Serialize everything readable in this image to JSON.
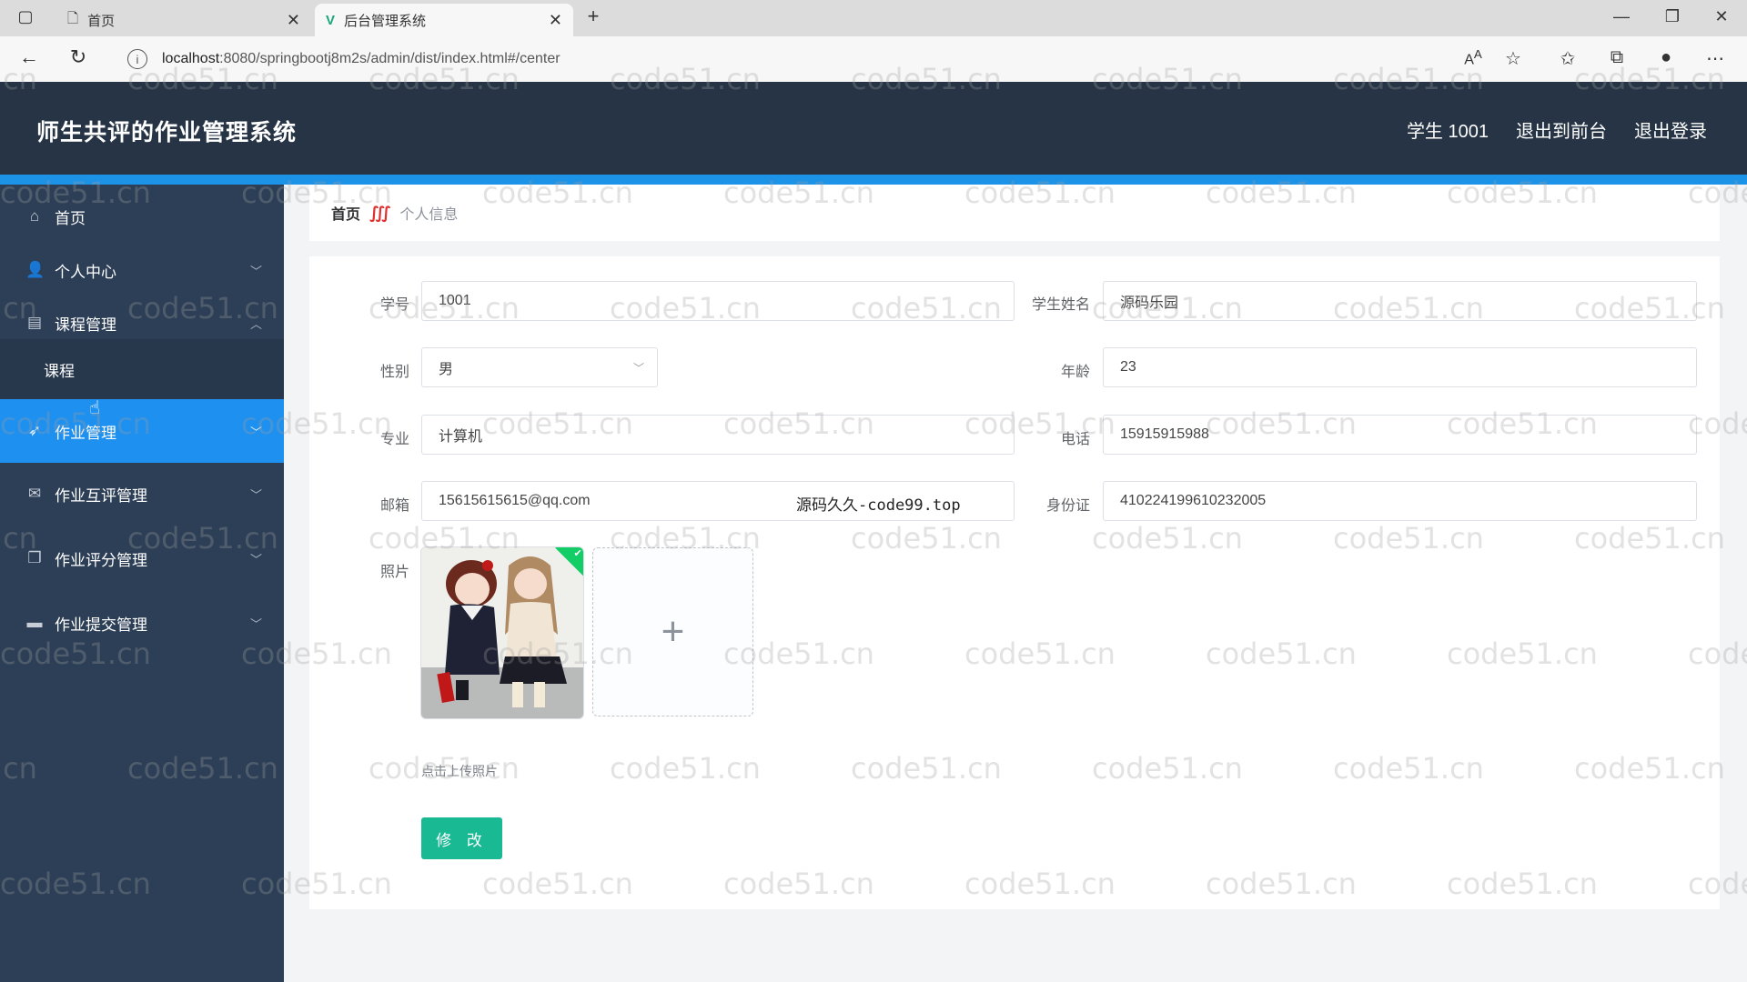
{
  "browser": {
    "tabs": [
      {
        "title": "首页"
      },
      {
        "title": "后台管理系统"
      }
    ],
    "url_host": "localhost",
    "url_path": ":8080/springbootj8m2s/admin/dist/index.html#/center"
  },
  "header": {
    "app_title": "师生共评的作业管理系统",
    "user": "学生 1001",
    "back_to_front": "退出到前台",
    "logout": "退出登录"
  },
  "sidebar": {
    "items": [
      {
        "label": "首页",
        "icon": "home-icon"
      },
      {
        "label": "个人中心",
        "icon": "user-icon"
      },
      {
        "label": "课程管理",
        "icon": "clipboard-icon",
        "expanded": true
      },
      {
        "label": "课程",
        "sub": true
      },
      {
        "label": "作业管理",
        "icon": "send-icon",
        "active": true
      },
      {
        "label": "作业互评管理",
        "icon": "mail-icon"
      },
      {
        "label": "作业评分管理",
        "icon": "copy-icon"
      },
      {
        "label": "作业提交管理",
        "icon": "monitor-icon"
      }
    ]
  },
  "breadcrumb": {
    "home": "首页",
    "current": "个人信息"
  },
  "form": {
    "student_no_label": "学号",
    "student_no": "1001",
    "student_name_label": "学生姓名",
    "student_name": "源码乐园",
    "gender_label": "性别",
    "gender": "男",
    "age_label": "年龄",
    "age": "23",
    "major_label": "专业",
    "major": "计算机",
    "phone_label": "电话",
    "phone": "15915915988",
    "email_label": "邮箱",
    "email": "15615615615@qq.com",
    "id_card_label": "身份证",
    "id_card": "410224199610232005",
    "photo_label": "照片",
    "upload_tip": "点击上传照片",
    "submit": "修 改"
  },
  "overlay_text": "源码久久-code99.top",
  "watermark": "code51.cn",
  "colors": {
    "header_bg": "#263445",
    "sidebar_bg": "#2d3f57",
    "active_menu": "#1e90ef",
    "accent_strip": "#1d93e8",
    "submit_button": "#19b993"
  }
}
